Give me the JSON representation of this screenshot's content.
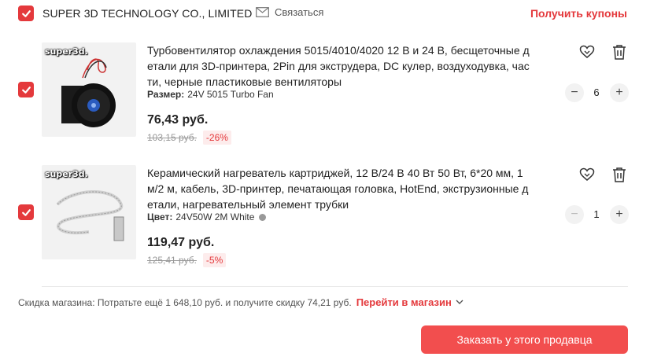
{
  "store": {
    "name": "SUPER 3D TECHNOLOGY CO., LIMITED",
    "contact_label": "Связаться",
    "coupons_label": "Получить купоны"
  },
  "items": [
    {
      "brand": "super3d.",
      "title": "Турбовентилятор охлаждения 5015/4010/4020 12 В и 24 В, бесщеточные детали для 3D-принтера, 2Pin для экструдера, DC кулер, воздуходувка, части, черные пластиковые вентиляторы",
      "variant_key": "Размер:",
      "variant_value": "24V 5015 Turbo Fan",
      "price": "76,43 руб.",
      "old_price": "103,15 руб.",
      "discount": "-26%",
      "quantity": "6",
      "checked": true
    },
    {
      "brand": "super3d.",
      "title": "Керамический нагреватель картриджей, 12 В/24 В 40 Вт 50 Вт, 6*20 мм, 1 м/2 м, кабель, 3D-принтер, печатающая головка, HotEnd, экструзионные детали, нагревательный элемент трубки",
      "variant_key": "Цвет:",
      "variant_value": "24V50W 2M White",
      "price": "119,47 руб.",
      "old_price": "125,41 руб.",
      "discount": "-5%",
      "quantity": "1",
      "checked": true
    }
  ],
  "footer": {
    "discount_text": "Скидка магазина:  Потратьте ещё 1 648,10 руб. и получите скидку 74,21 руб.",
    "goto_label": "Перейти в магазин",
    "order_button": "Заказать у этого продавца"
  },
  "colors": {
    "accent": "#e4393c",
    "button": "#f24e4e"
  }
}
